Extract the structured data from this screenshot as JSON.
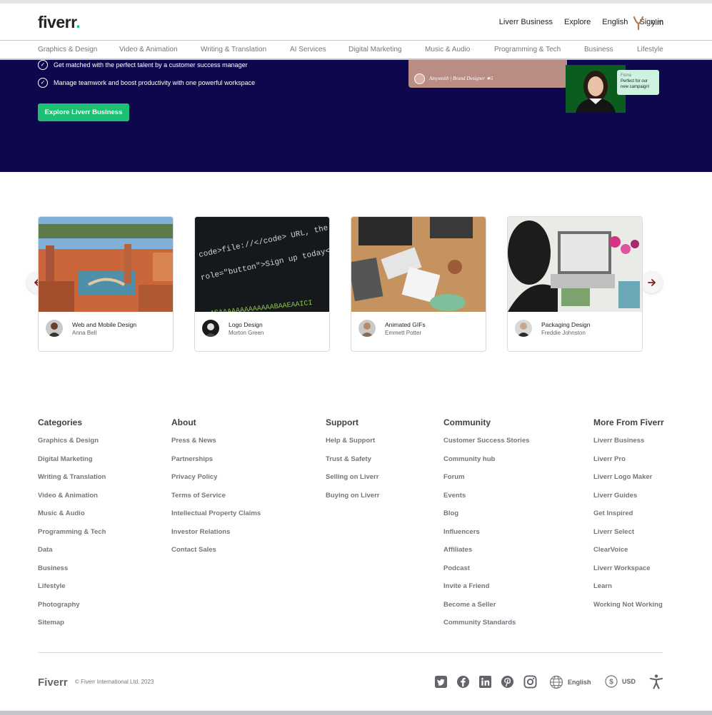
{
  "header": {
    "logo": "fiverr",
    "logo_dot": ".",
    "nav": [
      "Liverr Business",
      "Explore",
      "English",
      "Sign in"
    ],
    "username": "ylm"
  },
  "categories": [
    "Graphics & Design",
    "Video & Animation",
    "Writing & Translation",
    "AI Services",
    "Digital Marketing",
    "Music & Audio",
    "Programming & Tech",
    "Business",
    "Lifestyle"
  ],
  "hero": {
    "checks": [
      "Get matched with the perfect talent by a customer success manager",
      "Manage teamwork and boost productivity with one powerful workspace"
    ],
    "cta": "Explore Liverr Business",
    "card_caption": "Amysmith | Brand Designer ★5",
    "bubble_name": "Fiona",
    "bubble_text": "Perfect for our new campaign!",
    "bg_color": "#0d084d",
    "accent": "#1dbf73"
  },
  "carousel": {
    "cards": [
      {
        "title": "Web and Mobile Design",
        "author": "Anna Bell"
      },
      {
        "title": "Logo Design",
        "author": "Morton Green"
      },
      {
        "title": "Animated GIFs",
        "author": "Emmett Potter"
      },
      {
        "title": "Packaging Design",
        "author": "Freddie Johnston"
      }
    ]
  },
  "footer": {
    "columns": [
      {
        "title": "Categories",
        "links": [
          "Graphics & Design",
          "Digital Marketing",
          "Writing & Translation",
          "Video & Animation",
          "Music & Audio",
          "Programming & Tech",
          "Data",
          "Business",
          "Lifestyle",
          "Photography",
          "Sitemap"
        ]
      },
      {
        "title": "About",
        "links": [
          "Press & News",
          "Partnerships",
          "Privacy Policy",
          "Terms of Service",
          "Intellectual Property Claims",
          "Investor Relations",
          "Contact Sales"
        ]
      },
      {
        "title": "Support",
        "links": [
          "Help & Support",
          "Trust & Safety",
          "Selling on Liverr",
          "Buying on Liverr"
        ]
      },
      {
        "title": "Community",
        "links": [
          "Customer Success Stories",
          "Community hub",
          "Forum",
          "Events",
          "Blog",
          "Influencers",
          "Affiliates",
          "Podcast",
          "Invite a Friend",
          "Become a Seller",
          "Community Standards"
        ]
      },
      {
        "title": "More From Fiverr",
        "links": [
          "Liverr Business",
          "Liverr Pro",
          "Liverr Logo Maker",
          "Liverr Guides",
          "Get Inspired",
          "Liverr Select",
          "ClearVoice",
          "Liverr Workspace",
          "Learn",
          "Working Not Working"
        ]
      }
    ],
    "brand": "Fiverr",
    "copyright": "© Fiverr International Ltd. 2023",
    "language": "English",
    "currency": "USD",
    "social_icons": [
      "twitter-icon",
      "facebook-icon",
      "linkedin-icon",
      "pinterest-icon",
      "instagram-icon"
    ]
  }
}
